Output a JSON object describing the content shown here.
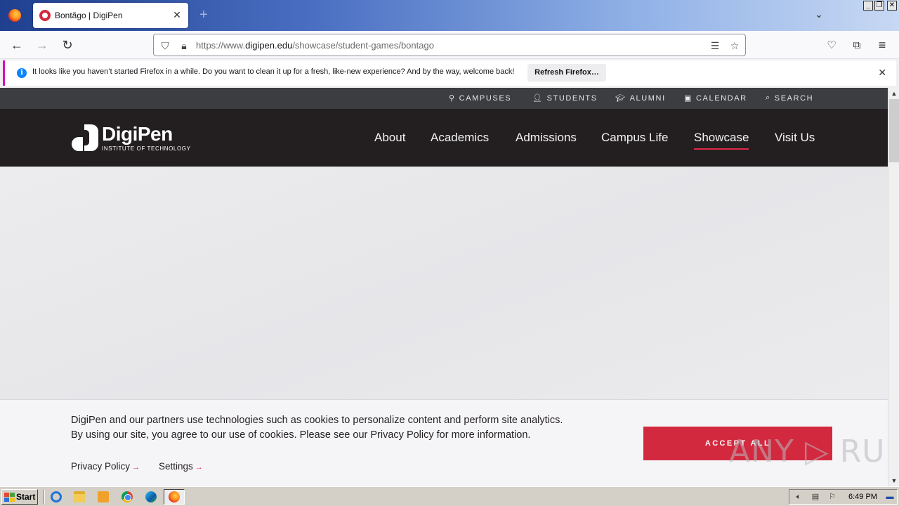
{
  "browser": {
    "tab_title": "Bontãgo | DigiPen",
    "tab_close": "✕",
    "new_tab": "+",
    "url_prefix": "https://www.",
    "url_domain": "digipen.edu",
    "url_path": "/showcase/student-games/bontago",
    "window_buttons": [
      "_",
      "❐",
      "✕"
    ]
  },
  "notification": {
    "message": "It looks like you haven’t started Firefox in a while. Do you want to clean it up for a fresh, like-new experience? And by the way, welcome back!",
    "button": "Refresh Firefox…",
    "close": "✕"
  },
  "site": {
    "utility_links": [
      "CAMPUSES",
      "STUDENTS",
      "ALUMNI",
      "CALENDAR",
      "SEARCH"
    ],
    "logo_name": "DigiPen",
    "logo_sub": "INSTITUTE OF TECHNOLOGY",
    "nav": [
      "About",
      "Academics",
      "Admissions",
      "Campus Life",
      "Showcase",
      "Visit Us"
    ],
    "active_nav": "Showcase",
    "accent_color": "#d3293f"
  },
  "cookie": {
    "text": "DigiPen and our partners use technologies such as cookies to personalize content and perform site analytics. By using our site, you agree to our use of cookies. Please see our Privacy Policy for more information.",
    "privacy_link": "Privacy Policy",
    "settings_link": "Settings",
    "accept": "ACCEPT ALL"
  },
  "watermark": "ANY ▷ RUN",
  "taskbar": {
    "start": "Start",
    "clock": "6:49 PM"
  }
}
